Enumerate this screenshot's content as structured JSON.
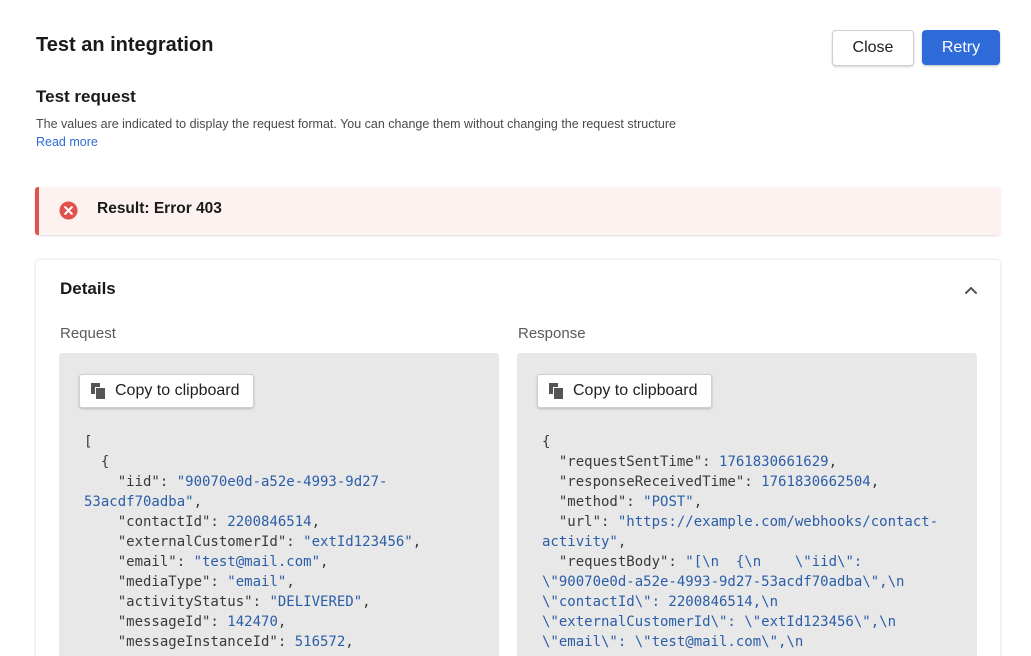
{
  "header": {
    "title": "Test an integration",
    "close_label": "Close",
    "retry_label": "Retry"
  },
  "test_request": {
    "title": "Test request",
    "description": "The values are indicated to display the request format. You can change them without changing the request structure",
    "read_more": "Read more"
  },
  "result": {
    "text": "Result: Error 403",
    "status_color": "#e0524b"
  },
  "details": {
    "title": "Details",
    "request_label": "Request",
    "response_label": "Response",
    "copy_label": "Copy to clipboard",
    "request_lines": [
      [
        [
          "k",
          "["
        ]
      ],
      [
        [
          "k",
          "  {"
        ]
      ],
      [
        [
          "k",
          "    \"iid\": "
        ],
        [
          "s",
          "\"90070e0d-a52e-4993-9d27-"
        ]
      ],
      [
        [
          "s",
          "53acdf70adba\""
        ],
        [
          "k",
          ","
        ]
      ],
      [
        [
          "k",
          "    \"contactId\": "
        ],
        [
          "n",
          "2200846514"
        ],
        [
          "k",
          ","
        ]
      ],
      [
        [
          "k",
          "    \"externalCustomerId\": "
        ],
        [
          "s",
          "\"extId123456\""
        ],
        [
          "k",
          ","
        ]
      ],
      [
        [
          "k",
          "    \"email\": "
        ],
        [
          "s",
          "\"test@mail.com\""
        ],
        [
          "k",
          ","
        ]
      ],
      [
        [
          "k",
          "    \"mediaType\": "
        ],
        [
          "s",
          "\"email\""
        ],
        [
          "k",
          ","
        ]
      ],
      [
        [
          "k",
          "    \"activityStatus\": "
        ],
        [
          "s",
          "\"DELIVERED\""
        ],
        [
          "k",
          ","
        ]
      ],
      [
        [
          "k",
          "    \"messageId\": "
        ],
        [
          "n",
          "142470"
        ],
        [
          "k",
          ","
        ]
      ],
      [
        [
          "k",
          "    \"messageInstanceId\": "
        ],
        [
          "n",
          "516572"
        ],
        [
          "k",
          ","
        ]
      ]
    ],
    "response_lines": [
      [
        [
          "k",
          "{"
        ]
      ],
      [
        [
          "k",
          "  \"requestSentTime\": "
        ],
        [
          "n",
          "1761830661629"
        ],
        [
          "k",
          ","
        ]
      ],
      [
        [
          "k",
          "  \"responseReceivedTime\": "
        ],
        [
          "n",
          "1761830662504"
        ],
        [
          "k",
          ","
        ]
      ],
      [
        [
          "k",
          "  \"method\": "
        ],
        [
          "s",
          "\"POST\""
        ],
        [
          "k",
          ","
        ]
      ],
      [
        [
          "k",
          "  \"url\": "
        ],
        [
          "s",
          "\"https://example.com/webhooks/contact-"
        ]
      ],
      [
        [
          "s",
          "activity\""
        ],
        [
          "k",
          ","
        ]
      ],
      [
        [
          "k",
          "  \"requestBody\": "
        ],
        [
          "s",
          "\"[\\n  {\\n    \\\"iid\\\":"
        ]
      ],
      [
        [
          "s",
          "\\\"90070e0d-a52e-4993-9d27-53acdf70adba\\\",\\n"
        ]
      ],
      [
        [
          "s",
          "\\\"contactId\\\": 2200846514,\\n"
        ]
      ],
      [
        [
          "s",
          "\\\"externalCustomerId\\\": \\\"extId123456\\\",\\n"
        ]
      ],
      [
        [
          "s",
          "\\\"email\\\": \\\"test@mail.com\\\",\\n"
        ]
      ]
    ]
  },
  "icons": {
    "error": "error-circle-icon",
    "copy": "copy-icon",
    "collapse": "chevron-up-icon"
  },
  "colors": {
    "primary": "#2f6bd8",
    "error": "#e0524b",
    "code_value": "#2b5ea8"
  }
}
